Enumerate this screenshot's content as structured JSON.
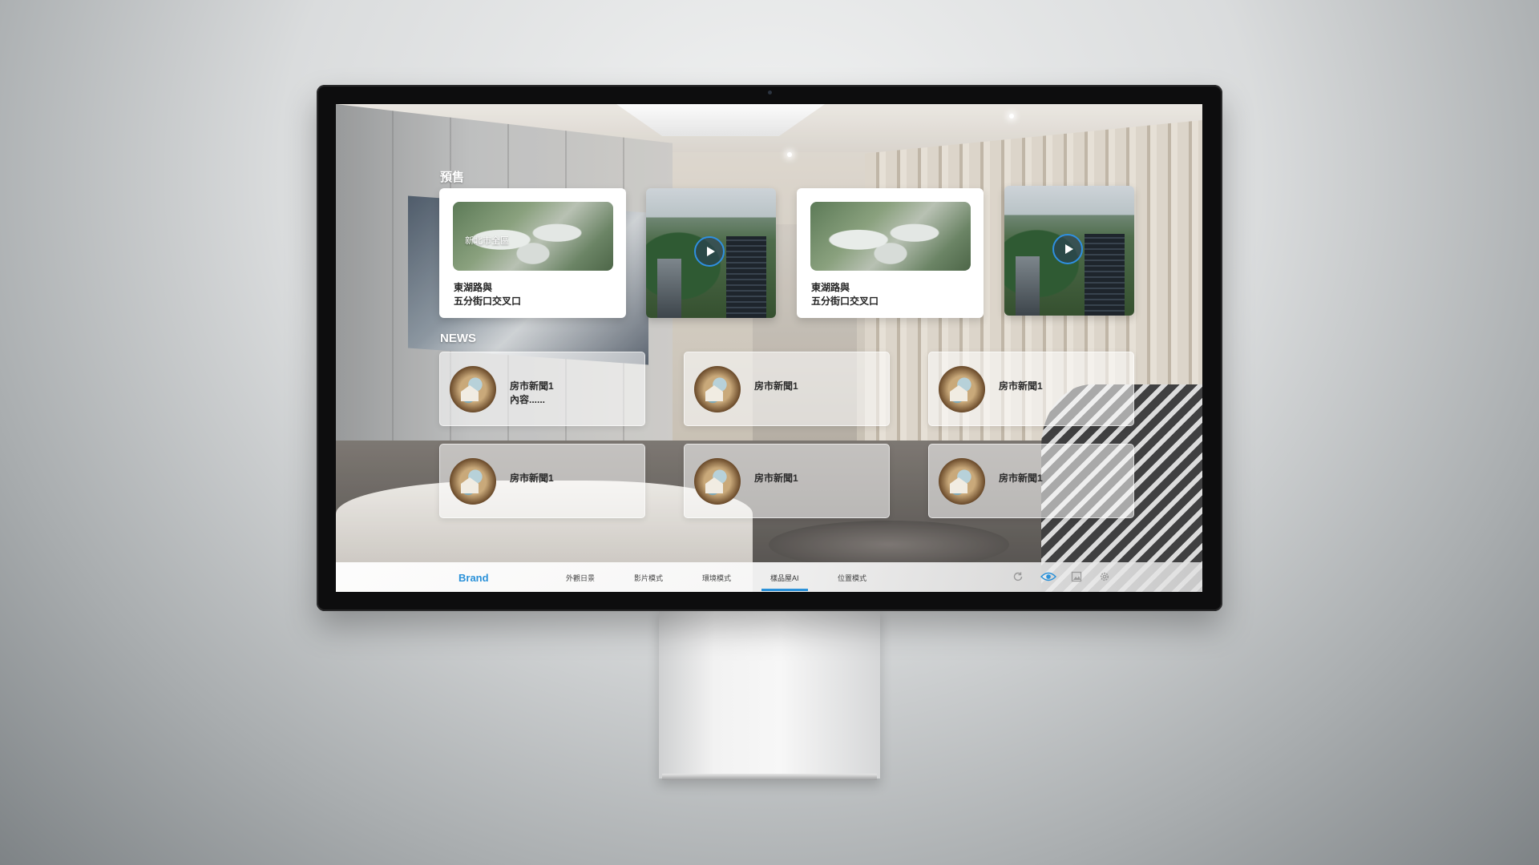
{
  "presale": {
    "title": "預售",
    "cards": [
      {
        "thumb_label": "新北市全區",
        "line1": "東湖路與",
        "line2": "五分街口交叉口"
      },
      {
        "thumb_label": "",
        "line1": "東湖路與",
        "line2": "五分街口交叉口"
      }
    ]
  },
  "news": {
    "title": "NEWS",
    "items": [
      {
        "title": "房市新聞1",
        "sub": "內容......"
      },
      {
        "title": "房市新聞1",
        "sub": ""
      },
      {
        "title": "房市新聞1",
        "sub": ""
      },
      {
        "title": "房市新聞1",
        "sub": ""
      },
      {
        "title": "房市新聞1",
        "sub": ""
      },
      {
        "title": "房市新聞1",
        "sub": ""
      }
    ]
  },
  "bottom_bar": {
    "brand": "Brand",
    "nav": [
      {
        "label": "外觀日景"
      },
      {
        "label": "影片模式"
      },
      {
        "label": "環境模式"
      },
      {
        "label": "樣品屋AI",
        "active": true
      },
      {
        "label": "位置模式"
      }
    ],
    "tools": [
      "refresh-icon",
      "eye-icon",
      "screenshot-icon",
      "gear-icon"
    ]
  },
  "colors": {
    "accent": "#2a91d9",
    "card_bg": "#ffffff",
    "text_dark": "#222222"
  }
}
